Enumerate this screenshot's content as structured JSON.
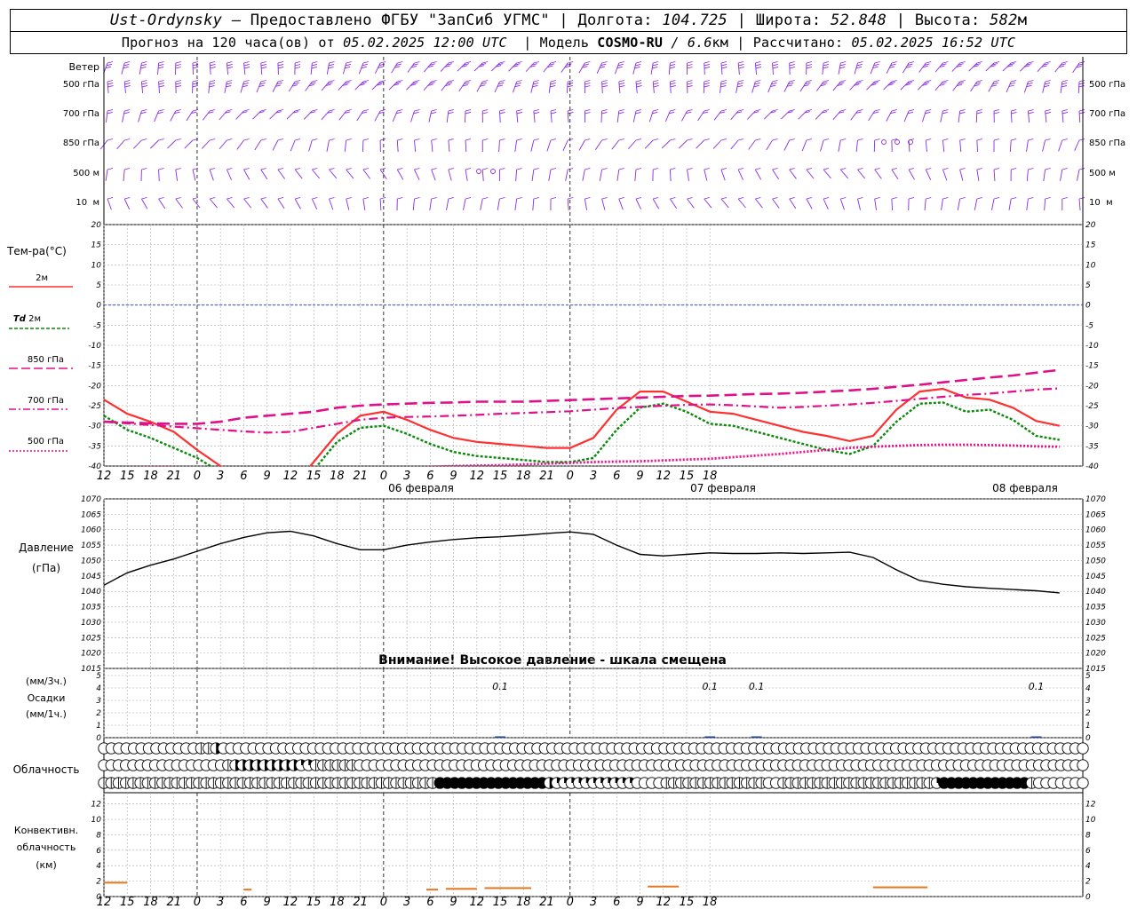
{
  "header": {
    "station": "Ust-Ordynsky",
    "provider": "— Предоставлено ФГБУ \"ЗапСиб УГМС\"",
    "lon_label": "Долгота:",
    "lon_value": "104.725",
    "lat_label": "Широта:",
    "lat_value": "52.848",
    "alt_label": "Высота:",
    "alt_value": "582",
    "alt_unit": "м",
    "forecast_prefix": "Прогноз на 120 часа(ов) от",
    "forecast_time": "05.02.2025 12:00 UTC",
    "model_label": "Модель",
    "model_name": "COSMO-RU",
    "model_res": "/ 6.6",
    "model_res_unit": "км",
    "calc_label": "Рассчитано:",
    "calc_time": "05.02.2025 16:52 UTC"
  },
  "labels": {
    "wind": "Ветер",
    "wind_levels": [
      "500 гПа",
      "700 гПа",
      "850 гПа",
      "500 м",
      "10  м"
    ],
    "temp_title": "Тем-ра(°C)",
    "t2m": "2м",
    "td_a": "Td",
    "td_b": "2м",
    "t850": "850 гПа",
    "t700": "700 гПа",
    "t500": "500 гПа",
    "pres_a": "Давление",
    "pres_b": "(гПа)",
    "pres_warning": "Внимание! Высокое давление - шкала смещена",
    "prec_a": "(мм/3ч.)",
    "prec_b": "Осадки",
    "prec_c": "(мм/1ч.)",
    "cloud": "Облачность",
    "conv_a": "Конвективн.",
    "conv_b": "облачность",
    "conv_c": "(км)"
  },
  "time_ticks": [
    "12",
    "15",
    "18",
    "21",
    "0",
    "3",
    "6",
    "9",
    "12",
    "15",
    "18",
    "21",
    "0",
    "3",
    "6",
    "9",
    "12",
    "15",
    "18",
    "21",
    "0",
    "3",
    "6",
    "9",
    "12",
    "15",
    "18"
  ],
  "date_labels": [
    "06 февраля",
    "07 февраля",
    "08 февраля"
  ],
  "chart_data": [
    {
      "type": "line",
      "name": "temperature",
      "x_hours": [
        0,
        3,
        6,
        9,
        12,
        15,
        18,
        21,
        24,
        27,
        30,
        33,
        36,
        39,
        42,
        45,
        48,
        51,
        54,
        57,
        60,
        63,
        66,
        69,
        72,
        75,
        78,
        81,
        84,
        87,
        90,
        93,
        96,
        99,
        102,
        105,
        108,
        111,
        114,
        117,
        120,
        123,
        126
      ],
      "ylim": [
        -40,
        20
      ],
      "yticks": [
        20,
        15,
        10,
        5,
        0,
        -5,
        -10,
        -15,
        -20,
        -25,
        -30,
        -35,
        -40
      ],
      "series": [
        {
          "name": "2м",
          "color": "#ff3030",
          "values": [
            -23.5,
            -27,
            -29,
            -31.5,
            -36,
            -40,
            -42,
            -45,
            -46,
            -39,
            -32,
            -27.5,
            -26.5,
            -28.5,
            -31,
            -33,
            -34,
            -34.5,
            -35,
            -35.5,
            -35.5,
            -33,
            -26,
            -21.5,
            -21.5,
            -24,
            -26.5,
            -27,
            -28.5,
            -30,
            -31.5,
            -32.5,
            -33.8,
            -32.5,
            -26,
            -21.5,
            -20.8,
            -23,
            -23.5,
            -25.5,
            -28.8,
            -30
          ]
        },
        {
          "name": "Td 2м",
          "color": "#0a8a0a",
          "values": [
            -27.5,
            -31,
            -33,
            -35.5,
            -38,
            -41.5,
            -44,
            -47,
            -48,
            -41,
            -34,
            -30.5,
            -30,
            -32,
            -34.5,
            -36.5,
            -37.5,
            -38,
            -38.5,
            -39,
            -39,
            -38,
            -31,
            -25.5,
            -24.5,
            -26.5,
            -29.5,
            -30,
            -31.5,
            -33,
            -34.5,
            -36,
            -37,
            -35,
            -29,
            -24.5,
            -24.2,
            -26.5,
            -26,
            -28.5,
            -32.5,
            -33.5
          ]
        },
        {
          "name": "850 гПа",
          "color": "#e0108a",
          "values": [
            -29,
            -29.2,
            -29.4,
            -29.5,
            -29.5,
            -29,
            -28,
            -27.5,
            -27,
            -26.5,
            -25.5,
            -25,
            -24.7,
            -24.5,
            -24.3,
            -24.2,
            -24,
            -24,
            -24,
            -23.8,
            -23.6,
            -23.4,
            -23.2,
            -23,
            -22.8,
            -22.6,
            -22.5,
            -22.3,
            -22.1,
            -22,
            -21.8,
            -21.5,
            -21.2,
            -20.8,
            -20.3,
            -19.8,
            -19.2,
            -18.6,
            -18,
            -17.5,
            -16.8,
            -16.1
          ]
        },
        {
          "name": "700 гПа",
          "color": "#e0108a",
          "values": [
            -29,
            -29.4,
            -29.8,
            -30.2,
            -30.6,
            -31,
            -31.4,
            -31.7,
            -31.5,
            -30.5,
            -29.5,
            -28.5,
            -28,
            -27.8,
            -27.7,
            -27.5,
            -27.3,
            -27,
            -26.8,
            -26.6,
            -26.4,
            -26,
            -25.6,
            -25.3,
            -25,
            -24.8,
            -24.7,
            -24.9,
            -25.2,
            -25.5,
            -25.3,
            -25,
            -24.7,
            -24.3,
            -23.8,
            -23.3,
            -22.8,
            -22.3,
            -22,
            -21.5,
            -21,
            -20.7
          ]
        },
        {
          "name": "500 гПа",
          "color": "#e0108a",
          "values": [
            -40.5,
            -40.3,
            -40.2,
            -40.2,
            -40.5,
            -40.8,
            -41,
            -41.2,
            -41.3,
            -41.2,
            -41,
            -40.8,
            -40.6,
            -40.4,
            -40.2,
            -40,
            -39.9,
            -39.8,
            -39.6,
            -39.4,
            -39.2,
            -39,
            -38.9,
            -38.8,
            -38.6,
            -38.4,
            -38.2,
            -37.8,
            -37.4,
            -37,
            -36.5,
            -36,
            -35.5,
            -35.2,
            -35,
            -34.8,
            -34.7,
            -34.7,
            -34.8,
            -34.9,
            -35.1,
            -35.2
          ]
        }
      ]
    },
    {
      "type": "line",
      "name": "pressure",
      "x_hours": [
        0,
        3,
        6,
        9,
        12,
        15,
        18,
        21,
        24,
        27,
        30,
        33,
        36,
        39,
        42,
        45,
        48,
        51,
        54,
        57,
        60,
        63,
        66,
        69,
        72,
        75,
        78,
        81,
        84,
        87,
        90,
        93,
        96,
        99,
        102,
        105,
        108,
        111,
        114,
        117,
        120,
        123,
        126
      ],
      "ylim": [
        1015,
        1070
      ],
      "yticks": [
        1070,
        1065,
        1060,
        1055,
        1050,
        1045,
        1040,
        1035,
        1030,
        1025,
        1020,
        1015
      ],
      "series": [
        {
          "name": "Давление",
          "color": "#000000",
          "values": [
            1042,
            1046,
            1048.5,
            1050.5,
            1053,
            1055.5,
            1057.5,
            1059,
            1059.5,
            1058,
            1055.5,
            1053.5,
            1053.5,
            1055,
            1056,
            1056.8,
            1057.4,
            1057.7,
            1058.2,
            1058.8,
            1059.3,
            1058.5,
            1055,
            1052,
            1051.5,
            1052,
            1052.5,
            1052.3,
            1052.3,
            1052.5,
            1052.3,
            1052.5,
            1052.7,
            1051,
            1047,
            1043.5,
            1042.3,
            1041.5,
            1041,
            1040.6,
            1040.2,
            1039.5
          ]
        }
      ]
    },
    {
      "type": "bar",
      "name": "precipitation",
      "ylim": [
        0,
        5
      ],
      "yticks": [
        5,
        4,
        3,
        2,
        1,
        0
      ],
      "annotations": [
        {
          "x_hour": 51,
          "text": "0.1"
        },
        {
          "x_hour": 78,
          "text": "0.1"
        },
        {
          "x_hour": 84,
          "text": "0.1"
        },
        {
          "x_hour": 120,
          "text": "0.1"
        }
      ]
    },
    {
      "type": "bar",
      "name": "convective_cloud",
      "ylim": [
        0,
        13
      ],
      "yticks": [
        12,
        10,
        8,
        6,
        4,
        2,
        0
      ],
      "bars": [
        {
          "x0": 0,
          "x1": 3,
          "value": 1.8,
          "color": "#e07820"
        },
        {
          "x0": 18,
          "x1": 19,
          "value": 0.9,
          "color": "#e07820"
        },
        {
          "x0": 41.5,
          "x1": 43,
          "value": 0.9,
          "color": "#e07820"
        },
        {
          "x0": 44,
          "x1": 48,
          "value": 1.0,
          "color": "#e07820"
        },
        {
          "x0": 49,
          "x1": 55,
          "value": 1.1,
          "color": "#e07820"
        },
        {
          "x0": 70,
          "x1": 74,
          "value": 1.3,
          "color": "#e07820"
        },
        {
          "x0": 99,
          "x1": 106,
          "value": 1.2,
          "color": "#e07820"
        }
      ]
    }
  ],
  "cloud_rows": {
    "upper": "000000000000011300000000000000000000000000000000000000000000000000000000000000000000000000000000000000000000000000000000000000000000",
    "middle": "000000000000000001334333333221111110000000000000000000000000000000000000000000000000000000000000000000000000000000000000000000000000000",
    "lower": "111111111111111111111111111111111111111111111144444444444444432222222222200001111111111111100111111111111111111111244444444444410000000"
  }
}
